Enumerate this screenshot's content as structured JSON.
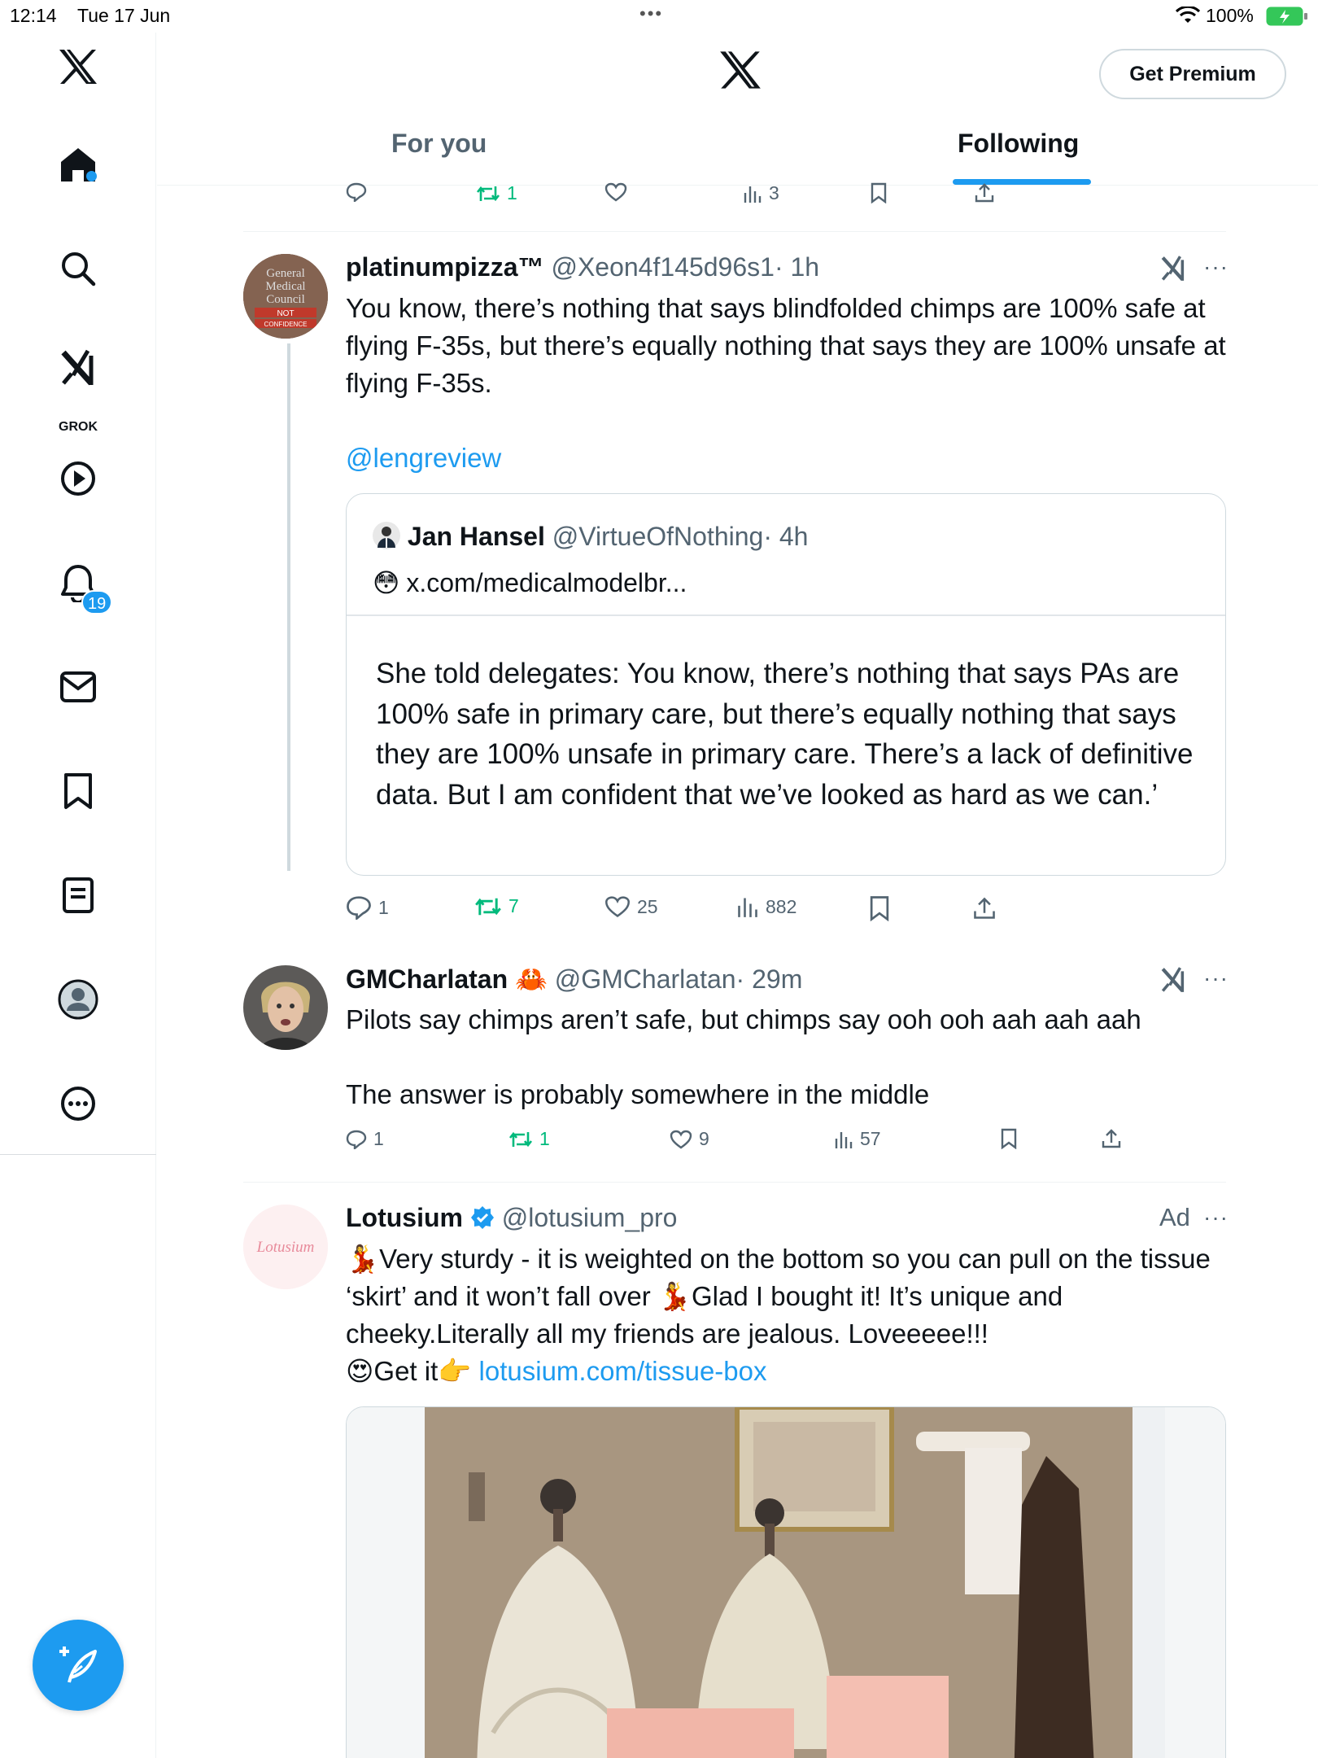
{
  "status_bar": {
    "time": "12:14",
    "date": "Tue 17 Jun",
    "dots": "•••",
    "battery": "100%"
  },
  "sidebar": {
    "grok_label": "GROK",
    "notifications_count": "19",
    "icons": [
      "x-logo-icon",
      "home-icon",
      "search-icon",
      "grok-icon",
      "video-icon",
      "notifications-icon",
      "messages-icon",
      "bookmarks-icon",
      "lists-icon",
      "profile-icon",
      "more-icon",
      "compose-icon"
    ]
  },
  "header": {
    "premium_label": "Get Premium",
    "tabs": [
      {
        "label": "For you"
      },
      {
        "label": "Following"
      }
    ],
    "active_tab": "Following"
  },
  "feed": {
    "top_actions": {
      "replies": "",
      "reposts": "1",
      "likes": "",
      "views": "3"
    },
    "tweets": [
      {
        "name": "platinumpizza™",
        "handle": "@Xeon4f145d96s1",
        "time": "· 1h",
        "avatar_text": "General Medical Council NOT CONFIDENCE",
        "text": "You know, there’s nothing that says blindfolded chimps are 100% safe at flying F-35s, but there’s equally nothing that says they are 100% unsafe at flying F-35s.",
        "mention": "@lengreview",
        "quote": {
          "name": "Jan Hansel",
          "handle": "@VirtueOfNothing",
          "time": "· 4h",
          "emoji": "😳",
          "link": "x.com/medicalmodelbr...",
          "body": "She told delegates: You know, there’s nothing that says PAs are 100% safe in primary care, but there’s equally nothing that says they are 100% unsafe in primary care. There’s a lack of definitive data. But I am confident that we’ve looked as hard as we can.’"
        },
        "actions": {
          "replies": "1",
          "reposts": "7",
          "likes": "25",
          "views": "882"
        }
      },
      {
        "name": "GMCharlatan",
        "name_emoji": "🦀",
        "handle": "@GMCharlatan",
        "time": "· 29m",
        "text_line1": "Pilots say chimps aren’t safe, but chimps say ooh ooh aah aah aah",
        "text_line2": "The answer is probably somewhere in the middle",
        "actions": {
          "replies": "1",
          "reposts": "1",
          "likes": "9",
          "views": "57"
        }
      },
      {
        "name": "Lotusium",
        "handle": "@lotusium_pro",
        "ad_label": "Ad",
        "avatar_text": "Lotusium",
        "emoji_dancer": "💃",
        "text_part1": "Very sturdy - it is weighted on the bottom so you can pull on the tissue ‘skirt’ and it won’t fall over ",
        "text_part2": "Glad I bought it! It’s unique and cheeky.Literally all my friends are jealous. Loveeeee!!!",
        "emoji_eyes": "😍",
        "cta": "Get it",
        "emoji_point": "👉",
        "link": "lotusium.com/tissue-box"
      }
    ]
  },
  "colors": {
    "accent": "#1d9bf0",
    "repost": "#00ba7c",
    "muted": "#536471",
    "text": "#0f1419"
  }
}
